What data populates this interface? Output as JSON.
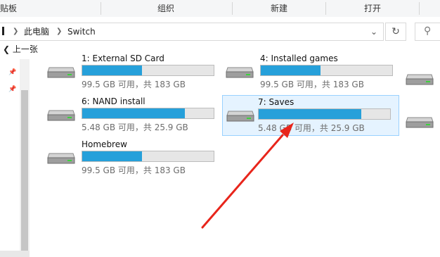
{
  "ribbon": {
    "groups": [
      {
        "label": "贴板"
      },
      {
        "label": "组织"
      },
      {
        "label": "新建"
      },
      {
        "label": "打开"
      }
    ]
  },
  "address": {
    "crumbs": [
      "此电脑",
      "Switch"
    ]
  },
  "nav": {
    "back_label": "上一张"
  },
  "drives": [
    {
      "name": "1: External SD Card",
      "info": "99.5 GB 可用，共 183 GB",
      "used_fraction": 0.46,
      "selected": false
    },
    {
      "name": "4: Installed games",
      "info": "99.5 GB 可用，共 183 GB",
      "used_fraction": 0.46,
      "selected": false
    },
    {
      "name": "6: NAND install",
      "info": "5.48 GB 可用，共 25.9 GB",
      "used_fraction": 0.79,
      "selected": false
    },
    {
      "name": "7: Saves",
      "info": "5.48 GB 可用，共 25.9 GB",
      "used_fraction": 0.79,
      "selected": true
    },
    {
      "name": "Homebrew",
      "info": "99.5 GB 可用，共 183 GB",
      "used_fraction": 0.46,
      "selected": false
    }
  ],
  "colors": {
    "bar_fill": "#26a0da",
    "selection_bg": "#e5f3ff",
    "selection_border": "#99d1ff",
    "annotation_arrow": "#e8251b"
  }
}
